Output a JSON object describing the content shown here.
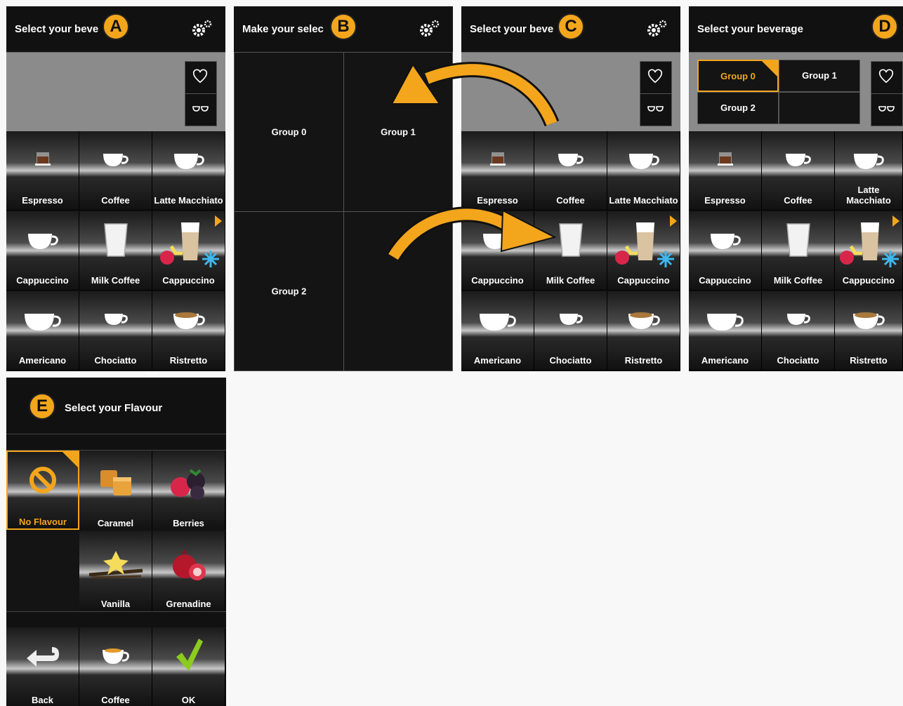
{
  "panels": {
    "a": {
      "badge": "A",
      "title": "Select your beve"
    },
    "b": {
      "badge": "B",
      "title": "Make your selec",
      "groups": [
        "Group 0",
        "Group 1",
        "Group 2"
      ]
    },
    "c": {
      "badge": "C",
      "title": "Select your beve"
    },
    "d": {
      "badge": "D",
      "title": "Select your beverage",
      "groups": [
        "Group 0",
        "Group 1",
        "Group 2"
      ]
    },
    "e": {
      "badge": "E",
      "title": "Select your Flavour"
    }
  },
  "beverages": [
    "Espresso",
    "Coffee",
    "Latte Macchiato",
    "Cappuccino",
    "Milk Coffee",
    "Cappuccino",
    "Americano",
    "Chociatto",
    "Ristretto"
  ],
  "flavours": {
    "items": [
      "No Flavour",
      "Caramel",
      "Berries",
      "Vanilla",
      "Grenadine"
    ],
    "selected": "No Flavour"
  },
  "footer": {
    "back": "Back",
    "coffee": "Coffee",
    "ok": "OK"
  },
  "icons": {
    "settings": "gears-icon",
    "favourite": "heart-icon",
    "double": "two-cups-icon"
  },
  "colors": {
    "accent": "#f3a51c",
    "panel": "#141414",
    "favbar": "#8b8b8b",
    "ok": "#8ccc1e"
  }
}
